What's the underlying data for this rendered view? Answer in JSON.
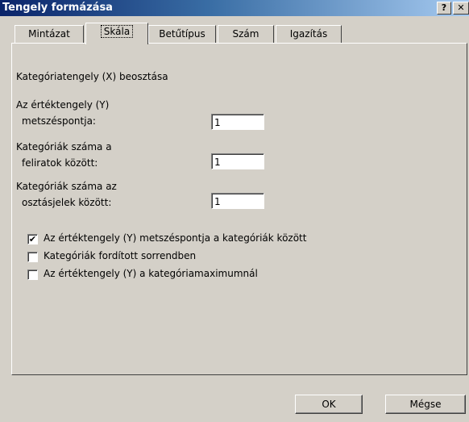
{
  "window": {
    "title": "Tengely formázása",
    "help_label": "?",
    "close_label": "✕"
  },
  "tabs": [
    {
      "label": "Mintázat",
      "active": false
    },
    {
      "label": "Skála",
      "active": true
    },
    {
      "label": "Betűtípus",
      "active": false
    },
    {
      "label": "Szám",
      "active": false
    },
    {
      "label": "Igazítás",
      "active": false
    }
  ],
  "panel": {
    "heading": "Kategóriatengely (X) beosztása",
    "crosses_label_1": "Az értéktengely (Y)",
    "crosses_label_2": "metszéspontja:",
    "crosses_value": "1",
    "between_labels_1": "Kategóriák száma a",
    "between_labels_2": "feliratok között:",
    "between_labels_value": "1",
    "between_ticks_1": "Kategóriák száma az",
    "between_ticks_2": "osztásjelek között:",
    "between_ticks_value": "1",
    "checkboxes": [
      {
        "label": "Az értéktengely (Y) metszéspontja a kategóriák között",
        "checked": true
      },
      {
        "label": "Kategóriák fordított sorrendben",
        "checked": false
      },
      {
        "label": "Az értéktengely (Y) a kategóriamaximumnál",
        "checked": false
      }
    ]
  },
  "buttons": {
    "ok": "OK",
    "cancel": "Mégse"
  }
}
